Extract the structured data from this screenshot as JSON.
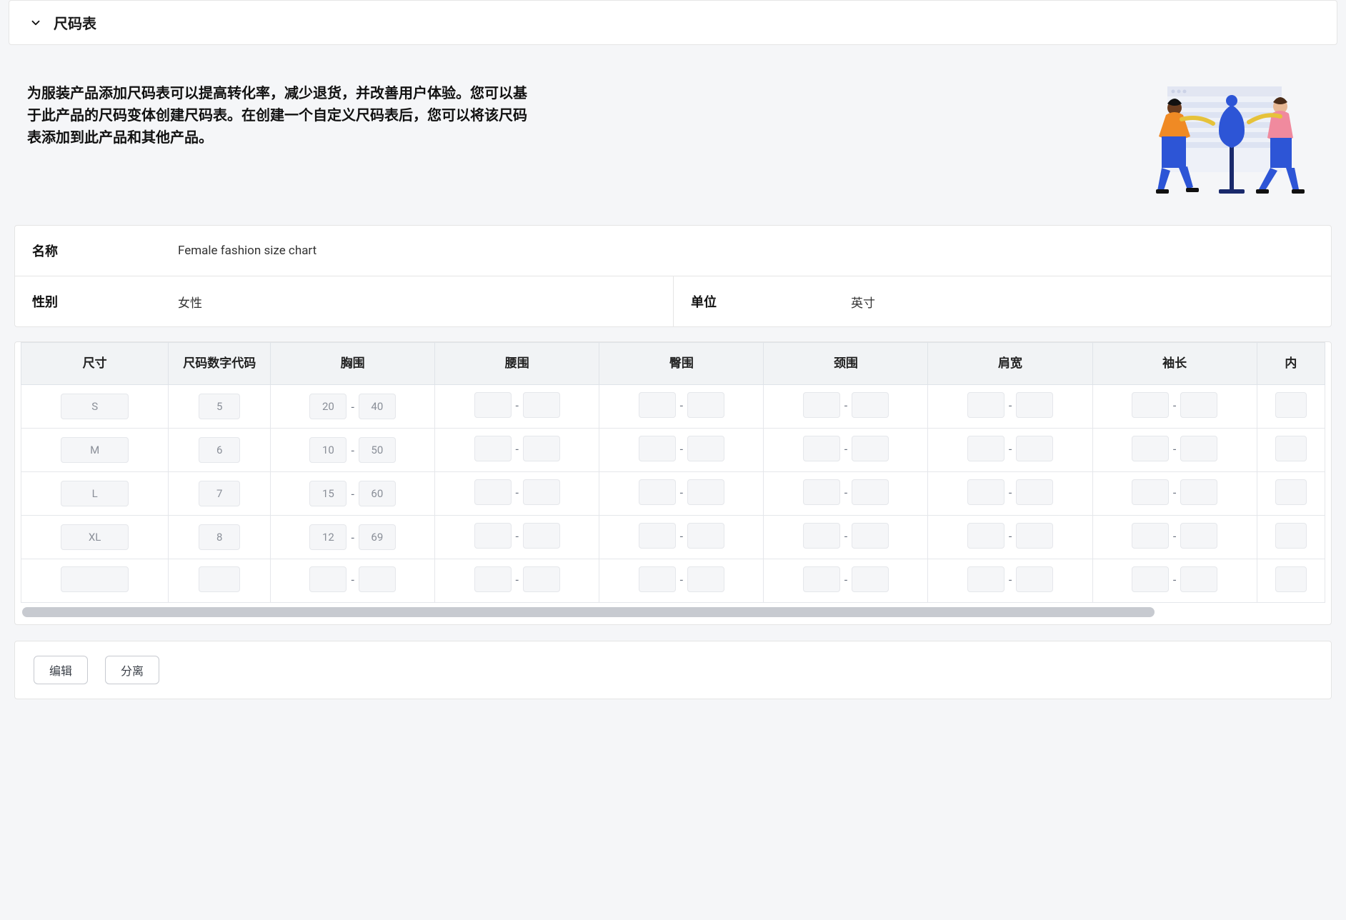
{
  "header": {
    "title": "尺码表"
  },
  "intro": {
    "text": "为服装产品添加尺码表可以提高转化率，减少退货，并改善用户体验。您可以基于此产品的尺码变体创建尺码表。在创建一个自定义尺码表后，您可以将该尺码表添加到此产品和其他产品。"
  },
  "meta": {
    "name_label": "名称",
    "name_value": "Female fashion size chart",
    "gender_label": "性别",
    "gender_value": "女性",
    "unit_label": "单位",
    "unit_value": "英寸"
  },
  "table": {
    "columns": [
      {
        "key": "size",
        "label": "尺寸",
        "type": "single"
      },
      {
        "key": "code",
        "label": "尺码数字代码",
        "type": "single"
      },
      {
        "key": "bust",
        "label": "胸围",
        "type": "range"
      },
      {
        "key": "waist",
        "label": "腰围",
        "type": "range"
      },
      {
        "key": "hip",
        "label": "臀围",
        "type": "range"
      },
      {
        "key": "neck",
        "label": "颈围",
        "type": "range"
      },
      {
        "key": "shoulder",
        "label": "肩宽",
        "type": "range"
      },
      {
        "key": "sleeve",
        "label": "袖长",
        "type": "range"
      },
      {
        "key": "inseam",
        "label": "内",
        "type": "range",
        "partial": true
      }
    ],
    "rows": [
      {
        "size": "S",
        "code": "5",
        "bust": [
          "20",
          "40"
        ],
        "waist": [
          "",
          ""
        ],
        "hip": [
          "",
          ""
        ],
        "neck": [
          "",
          ""
        ],
        "shoulder": [
          "",
          ""
        ],
        "sleeve": [
          "",
          ""
        ],
        "inseam": [
          "",
          ""
        ]
      },
      {
        "size": "M",
        "code": "6",
        "bust": [
          "10",
          "50"
        ],
        "waist": [
          "",
          ""
        ],
        "hip": [
          "",
          ""
        ],
        "neck": [
          "",
          ""
        ],
        "shoulder": [
          "",
          ""
        ],
        "sleeve": [
          "",
          ""
        ],
        "inseam": [
          "",
          ""
        ]
      },
      {
        "size": "L",
        "code": "7",
        "bust": [
          "15",
          "60"
        ],
        "waist": [
          "",
          ""
        ],
        "hip": [
          "",
          ""
        ],
        "neck": [
          "",
          ""
        ],
        "shoulder": [
          "",
          ""
        ],
        "sleeve": [
          "",
          ""
        ],
        "inseam": [
          "",
          ""
        ]
      },
      {
        "size": "XL",
        "code": "8",
        "bust": [
          "12",
          "69"
        ],
        "waist": [
          "",
          ""
        ],
        "hip": [
          "",
          ""
        ],
        "neck": [
          "",
          ""
        ],
        "shoulder": [
          "",
          ""
        ],
        "sleeve": [
          "",
          ""
        ],
        "inseam": [
          "",
          ""
        ]
      },
      {
        "size": "",
        "code": "",
        "bust": [
          "",
          ""
        ],
        "waist": [
          "",
          ""
        ],
        "hip": [
          "",
          ""
        ],
        "neck": [
          "",
          ""
        ],
        "shoulder": [
          "",
          ""
        ],
        "sleeve": [
          "",
          ""
        ],
        "inseam": [
          "",
          ""
        ]
      }
    ]
  },
  "actions": {
    "edit": "编辑",
    "detach": "分离"
  }
}
